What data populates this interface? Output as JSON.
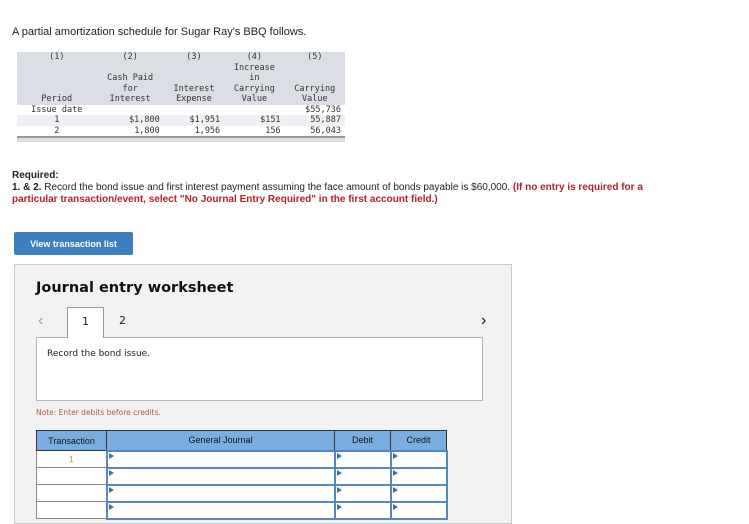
{
  "intro": "A partial amortization schedule for Sugar Ray's BBQ follows.",
  "schedule": {
    "col_numbers": [
      "(1)",
      "(2)",
      "(3)",
      "(4)",
      "(5)"
    ],
    "headers": [
      [
        "Period"
      ],
      [
        "Cash Paid",
        "for",
        "Interest"
      ],
      [
        "Interest",
        "Expense"
      ],
      [
        "Increase",
        "in",
        "Carrying",
        "Value"
      ],
      [
        "Carrying",
        "Value"
      ]
    ],
    "rows": [
      [
        "Issue date",
        "",
        "",
        "",
        "$55,736"
      ],
      [
        "1",
        "$1,800",
        "$1,951",
        "$151",
        "55,887"
      ],
      [
        "2",
        "1,800",
        "1,956",
        "156",
        "56,043"
      ]
    ]
  },
  "required": {
    "label": "Required:",
    "num": "1. & 2.",
    "text": " Record the bond issue and first interest payment assuming the face amount of bonds payable is $60,000. ",
    "note": "(If no entry is required for a particular transaction/event, select \"No Journal Entry Required\" in the first account field.)"
  },
  "view_button": "View transaction list",
  "worksheet": {
    "title": "Journal entry worksheet",
    "tabs": [
      "1",
      "2"
    ],
    "active_tab": "1",
    "description": "Record the bond issue.",
    "note": "Note: Enter debits before credits.",
    "columns": [
      "Transaction",
      "General Journal",
      "Debit",
      "Credit"
    ],
    "rows": [
      {
        "transaction": "1"
      },
      {
        "transaction": ""
      },
      {
        "transaction": ""
      },
      {
        "transaction": ""
      }
    ]
  }
}
